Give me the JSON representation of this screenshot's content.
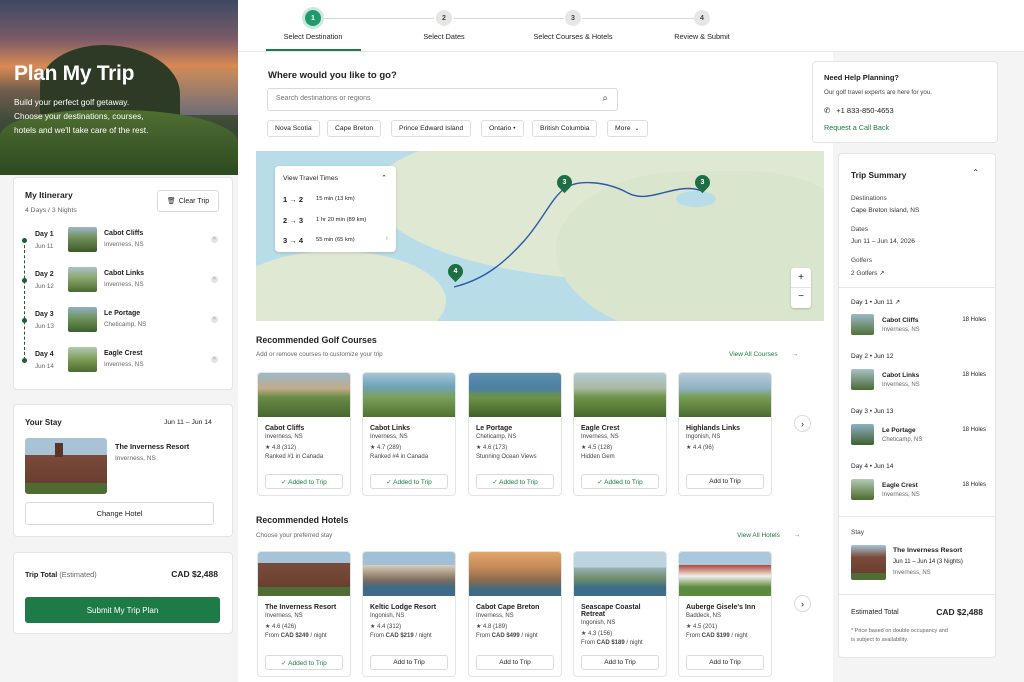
{
  "hero": {
    "title": "Plan My Trip",
    "subtitle_lines": [
      "Build your perfect golf getaway.",
      "Choose your destinations, courses,",
      "hotels and we'll take care of the rest."
    ]
  },
  "itinerary": {
    "title": "My Itinerary",
    "summary": "4 Days / 3 Nights",
    "clear_button": "Clear Trip",
    "days": [
      {
        "day": "Day 1",
        "date": "Jun 11",
        "course": "Cabot Cliffs",
        "location": "Inverness, NS"
      },
      {
        "day": "Day 2",
        "date": "Jun 12",
        "course": "Cabot Links",
        "location": "Inverness, NS"
      },
      {
        "day": "Day 3",
        "date": "Jun 13",
        "course": "Le Portage",
        "location": "Cheticamp, NS"
      },
      {
        "day": "Day 4",
        "date": "Jun 14",
        "course": "Eagle Crest",
        "location": "Inverness, NS"
      }
    ]
  },
  "stay": {
    "title": "Your Stay",
    "dates": "Jun 11 – Jun 14",
    "hotel": "The Inverness Resort",
    "location": "Inverness, NS",
    "change_button": "Change Hotel"
  },
  "total": {
    "label": "Trip Total",
    "label_suffix": "(Estimated)",
    "amount": "CAD $2,488",
    "submit_button": "Submit My Trip Plan"
  },
  "steps": [
    {
      "num": "1",
      "label": "Select Destination",
      "active": true
    },
    {
      "num": "2",
      "label": "Select Dates",
      "active": false
    },
    {
      "num": "3",
      "label": "Select Courses & Hotels",
      "active": false
    },
    {
      "num": "4",
      "label": "Review & Submit",
      "active": false
    }
  ],
  "search": {
    "heading": "Where would you like to go?",
    "placeholder": "Search destinations or regions"
  },
  "chips": [
    "Nova Scotia",
    "Cape Breton",
    "Prince Edward Island",
    "Ontario •",
    "British Columbia",
    "More"
  ],
  "help": {
    "title": "Need Help Planning?",
    "text": "Our golf travel experts are here for you.",
    "phone": "+1 833-850-4653",
    "callback": "Request a Call Back"
  },
  "travel_times": {
    "title": "View Travel Times",
    "rows": [
      {
        "route": "1 → 2",
        "time": "15 min (13 km)"
      },
      {
        "route": "2 → 3",
        "time": "1 hr 20 min (89 km)"
      },
      {
        "route": "3 → 4",
        "time": "55 min (65 km)"
      }
    ]
  },
  "map_pins": [
    "3",
    "3",
    "4"
  ],
  "courses": {
    "title": "Recommended Golf Courses",
    "subtitle": "Add or remove courses to customize your trip",
    "view_all": "View All Courses",
    "items": [
      {
        "name": "Cabot Cliffs",
        "location": "Inverness, NS",
        "rating": "★ 4.8 (312)",
        "note": "Ranked #1 in Canada",
        "button": "✓  Added to Trip"
      },
      {
        "name": "Cabot Links",
        "location": "Inverness, NS",
        "rating": "★ 4.7 (289)",
        "note": "Ranked #4 in Canada",
        "button": "✓  Added to Trip"
      },
      {
        "name": "Le Portage",
        "location": "Cheticamp, NS",
        "rating": "★ 4.6 (173)",
        "note": "Stunning Ocean Views",
        "button": "✓  Added to Trip"
      },
      {
        "name": "Eagle Crest",
        "location": "Inverness, NS",
        "rating": "★ 4.5 (128)",
        "note": "Hidden Gem",
        "button": "✓  Added to Trip"
      },
      {
        "name": "Highlands Links",
        "location": "Ingonish, NS",
        "rating": "★ 4.4 (96)",
        "note": "",
        "button": "Add to Trip"
      }
    ]
  },
  "hotels": {
    "title": "Recommended Hotels",
    "subtitle": "Choose your preferred stay",
    "view_all": "View All Hotels",
    "items": [
      {
        "name": "The Inverness Resort",
        "location": "Inverness, NS",
        "rating": "★ 4.6 (426)",
        "from": "From",
        "price": "CAD $249",
        "per": "/ night",
        "button": "✓  Added to Trip"
      },
      {
        "name": "Keltic Lodge Resort",
        "location": "Ingonish, NS",
        "rating": "★ 4.4 (312)",
        "from": "From",
        "price": "CAD $219",
        "per": "/ night",
        "button": "Add to Trip"
      },
      {
        "name": "Cabot Cape Breton",
        "location": "Inverness, NS",
        "rating": "★ 4.8 (189)",
        "from": "From",
        "price": "CAD $499",
        "per": "/ night",
        "button": "Add to Trip"
      },
      {
        "name": "Seascape Coastal Retreat",
        "location": "Ingonish, NS",
        "rating": "★ 4.3 (156)",
        "from": "From",
        "price": "CAD $189",
        "per": "/ night",
        "button": "Add to Trip"
      },
      {
        "name": "Auberge Gisele's Inn",
        "location": "Baddeck, NS",
        "rating": "★ 4.5 (201)",
        "from": "From",
        "price": "CAD $199",
        "per": "/ night",
        "button": "Add to Trip"
      }
    ]
  },
  "summary": {
    "title": "Trip Summary",
    "destinations_label": "Destinations",
    "destinations": "Cape Breton Island, NS",
    "dates_label": "Dates",
    "dates": "Jun 11 – Jun 14, 2026",
    "golfers_label": "Golfers",
    "golfers": "2 Golfers ↗",
    "days": [
      {
        "header": "Day 1  •  Jun 11  ↗",
        "course": "Cabot Cliffs",
        "location": "Inverness, NS",
        "holes": "18 Holes"
      },
      {
        "header": "Day 2  •  Jun 12",
        "course": "Cabot Links",
        "location": "Inverness, NS",
        "holes": "18 Holes"
      },
      {
        "header": "Day 3  •  Jun 13",
        "course": "Le Portage",
        "location": "Cheticamp, NS",
        "holes": "18 Holes"
      },
      {
        "header": "Day 4  •  Jun 14",
        "course": "Eagle Crest",
        "location": "Inverness, NS",
        "holes": "18 Holes"
      }
    ],
    "stay_label": "Stay",
    "stay_hotel": "The Inverness Resort",
    "stay_dates": "Jun 11 – Jun 14 (3 Nights)",
    "stay_location": "Inverness, NS",
    "total_label": "Estimated Total",
    "total": "CAD $2,488",
    "footnote_lines": [
      "* Price based on double occupancy and",
      "is subject to availability."
    ]
  },
  "colors": {
    "accent": "#1e7a46",
    "step_active": "#1f9a6c"
  }
}
